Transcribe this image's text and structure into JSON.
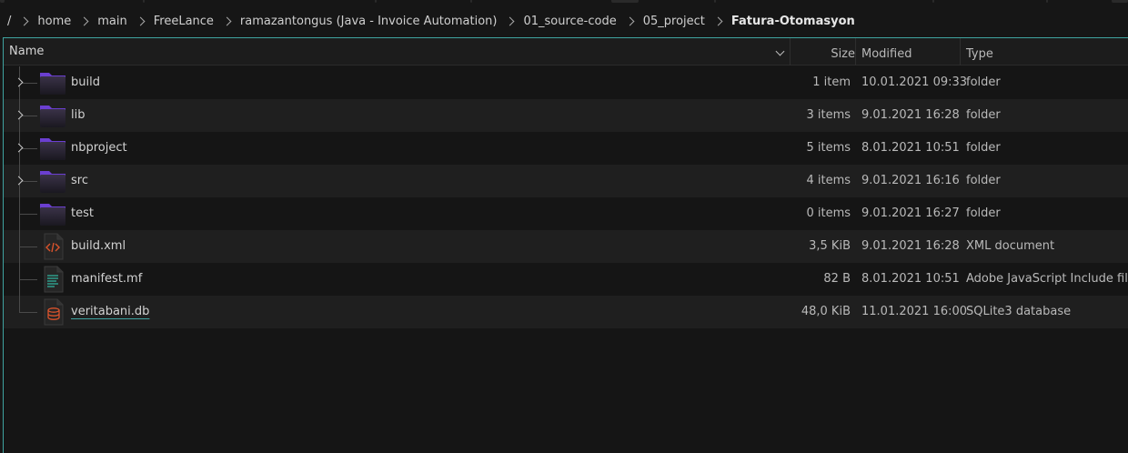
{
  "breadcrumb": {
    "root": "/",
    "segments": [
      "home",
      "main",
      "FreeLance",
      "ramazantongus (Java - Invoice Automation)",
      "01_source-code",
      "05_project"
    ],
    "current": "Fatura-Otomasyon"
  },
  "columns": {
    "name": "Name",
    "size": "Size",
    "modified": "Modified",
    "type": "Type"
  },
  "files": [
    {
      "name": "build",
      "size": "1 item",
      "modified": "10.01.2021 09:33",
      "type": "folder",
      "icon": "folder-icon",
      "expandable": true
    },
    {
      "name": "lib",
      "size": "3 items",
      "modified": "9.01.2021 16:28",
      "type": "folder",
      "icon": "folder-icon",
      "expandable": true
    },
    {
      "name": "nbproject",
      "size": "5 items",
      "modified": "8.01.2021 10:51",
      "type": "folder",
      "icon": "folder-icon",
      "expandable": true
    },
    {
      "name": "src",
      "size": "4 items",
      "modified": "9.01.2021 16:16",
      "type": "folder",
      "icon": "folder-icon",
      "expandable": true
    },
    {
      "name": "test",
      "size": "0 items",
      "modified": "9.01.2021 16:27",
      "type": "folder",
      "icon": "folder-icon",
      "expandable": false
    },
    {
      "name": "build.xml",
      "size": "3,5 KiB",
      "modified": "9.01.2021 16:28",
      "type": "XML document",
      "icon": "xml-file-icon",
      "expandable": false
    },
    {
      "name": "manifest.mf",
      "size": "82 B",
      "modified": "8.01.2021 10:51",
      "type": "Adobe JavaScript Include file",
      "icon": "text-file-icon",
      "expandable": false
    },
    {
      "name": "veritabani.db",
      "size": "48,0 KiB",
      "modified": "11.01.2021 16:00",
      "type": "SQLite3 database",
      "icon": "database-file-icon",
      "expandable": false
    }
  ],
  "colors": {
    "accent": "#3fa3a0",
    "folder_tab": "#6b3fd1",
    "background": "#151515",
    "row_alt": "#1f1f1f"
  }
}
